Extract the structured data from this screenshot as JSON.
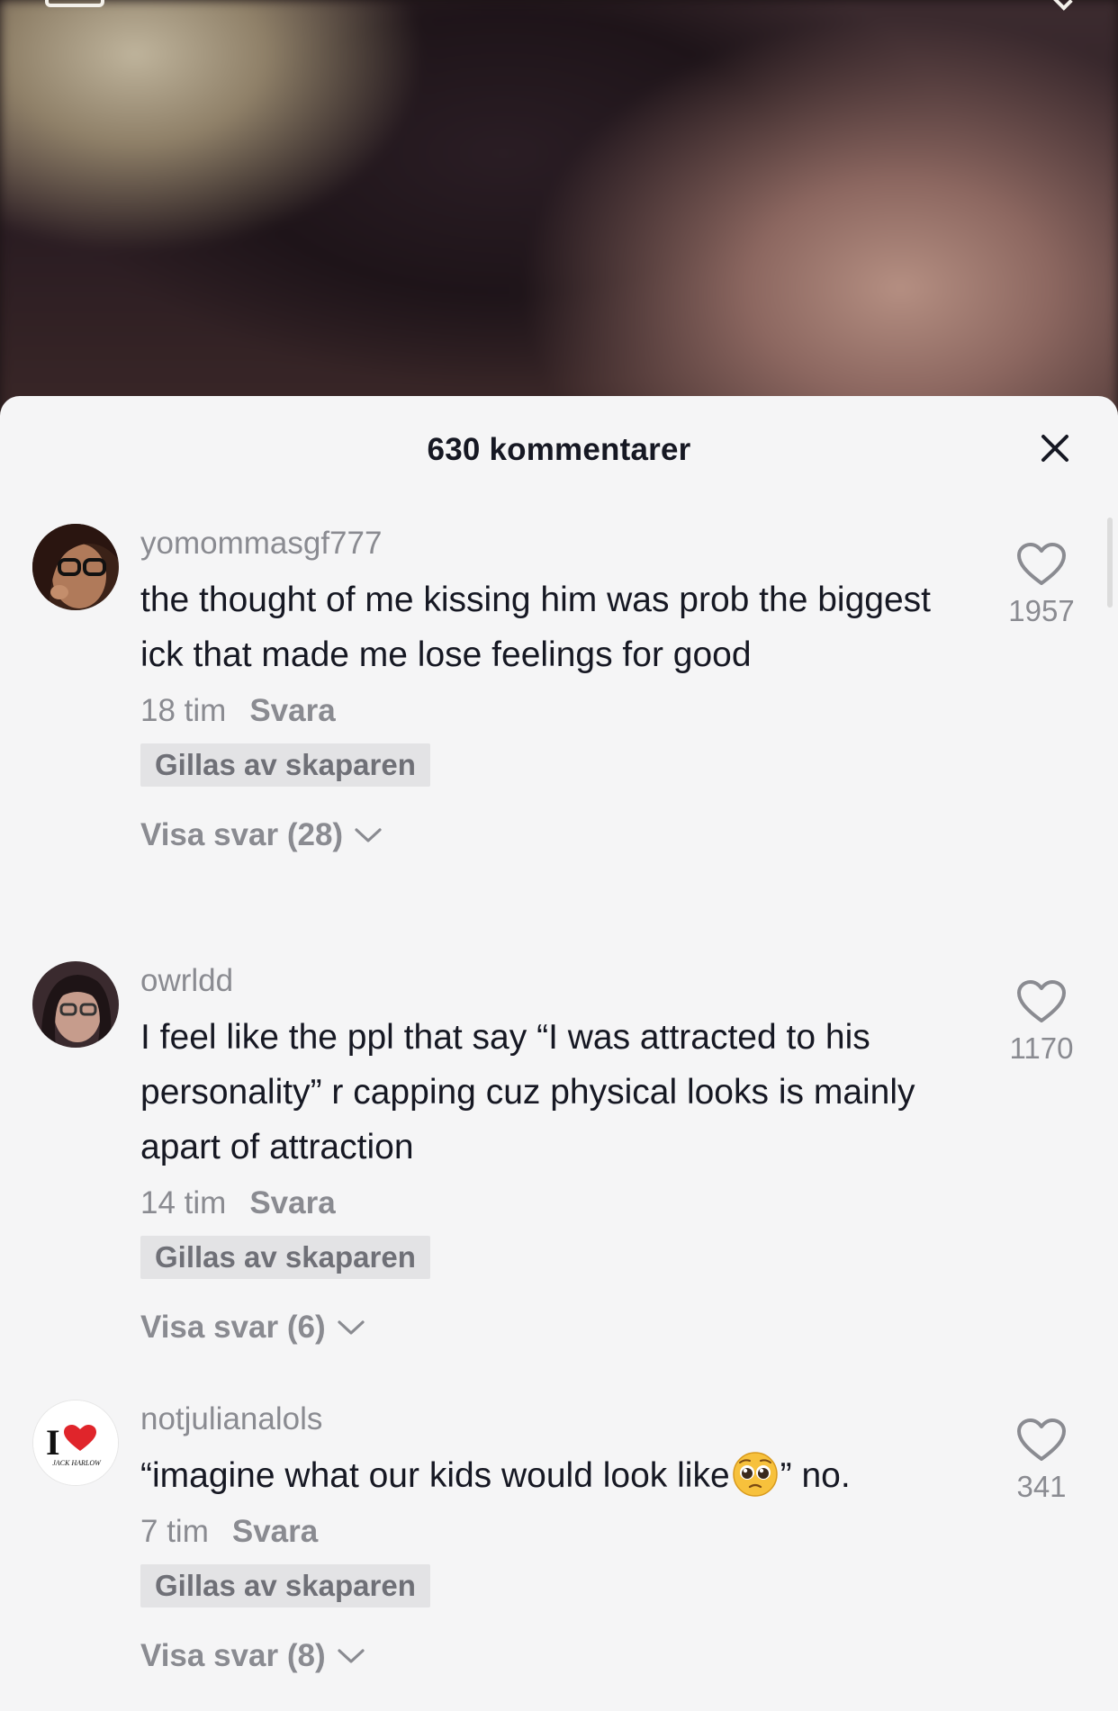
{
  "sheet": {
    "title": "630 kommentarer"
  },
  "comments": [
    {
      "username": "yomommasgf777",
      "text": "the thought of me kissing him was prob the biggest ick that made me lose feelings for good",
      "time": "18 tim",
      "reply_label": "Svara",
      "badge": "Gillas av skaparen",
      "view_replies": "Visa svar (28)",
      "likes": "1957"
    },
    {
      "username": "owrldd",
      "text": "I feel like the ppl that say “I was attracted to his personality” r capping cuz physical looks is mainly apart of attraction",
      "time": "14 tim",
      "reply_label": "Svara",
      "badge": "Gillas av skaparen",
      "view_replies": "Visa svar (6)",
      "likes": "1170"
    },
    {
      "username": "notjulianalols",
      "text_before_emoji": "“imagine what our kids would look like",
      "text_after_emoji": "” no.",
      "emoji": "pleading-face-emoji",
      "avatar_text_1": "I",
      "avatar_text_2": "JACK HARLOW",
      "time": "7 tim",
      "reply_label": "Svara",
      "badge": "Gillas av skaparen",
      "view_replies": "Visa svar (8)",
      "likes": "341"
    }
  ],
  "colors": {
    "sheet_bg": "#f5f5f6",
    "primary_text": "#161823",
    "secondary_text": "#8a8b91",
    "badge_bg": "#e3e3e5",
    "heart_red": "#e0252b"
  },
  "icons": [
    "close-icon",
    "heart-outline-icon",
    "chevron-down-icon"
  ]
}
